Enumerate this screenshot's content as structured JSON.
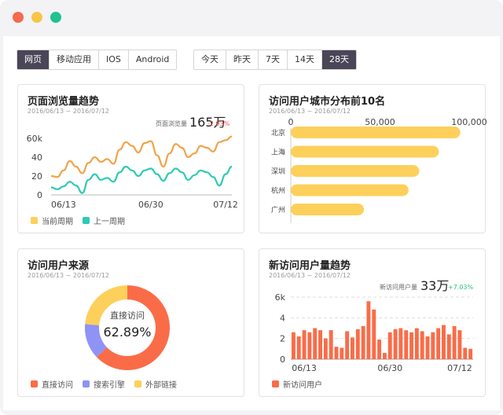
{
  "colors": {
    "orange": "#f0a44a",
    "teal": "#2fcab2",
    "yellow": "#fdd05b",
    "coral": "#fa6c48",
    "purple": "#8e93f5",
    "red_pct": "#f05050",
    "green_pct": "#2ec27e",
    "active_btn": "#4a4657"
  },
  "platform_tabs": [
    "网页",
    "移动应用",
    "IOS",
    "Android"
  ],
  "range_tabs": [
    "今天",
    "昨天",
    "7天",
    "14天",
    "28天"
  ],
  "cards": {
    "pv": {
      "title": "页面浏览量趋势",
      "date_range": "2016/06/13 ~ 2016/07/12",
      "stat_label": "页面浏览量",
      "stat_value": "165万",
      "stat_change": "-2.93%",
      "legend": [
        "当前周期",
        "上一周期"
      ]
    },
    "city": {
      "title": "访问用户城市分布前10名",
      "date_range": "2016/06/13 ~ 2016/07/12"
    },
    "source": {
      "title": "访问用户来源",
      "date_range": "2016/06/13 ~ 2016/07/12",
      "center_label": "直接访问",
      "center_value": "62.89%",
      "legend": [
        "直接访问",
        "搜索引擎",
        "外部链接"
      ]
    },
    "new_users": {
      "title": "新访问用户量趋势",
      "date_range": "2016/06/13 ~ 2016/07/12",
      "stat_label": "新访问用户量",
      "stat_value": "33万",
      "stat_change": "+7.03%",
      "legend": [
        "新访问用户"
      ]
    }
  },
  "chart_data": [
    {
      "type": "line",
      "y_ticks": [
        "60k",
        "40",
        "20",
        "0"
      ],
      "ylim": [
        0,
        65
      ],
      "x_ticks": [
        "06/13",
        "06/30",
        "07/12"
      ],
      "x": [
        0,
        1,
        2,
        3,
        4,
        5,
        6,
        7,
        8,
        9,
        10,
        11,
        12,
        13,
        14,
        15,
        16,
        17,
        18,
        19,
        20,
        21,
        22,
        23,
        24,
        25,
        26,
        27,
        28,
        29
      ],
      "series": [
        {
          "name": "当前周期",
          "values": [
            20,
            19,
            26,
            36,
            30,
            23,
            34,
            40,
            35,
            38,
            33,
            48,
            56,
            52,
            45,
            55,
            57,
            42,
            30,
            44,
            54,
            50,
            40,
            44,
            52,
            50,
            46,
            56,
            58,
            62
          ]
        },
        {
          "name": "上一周期",
          "values": [
            8,
            6,
            9,
            14,
            10,
            2,
            16,
            22,
            16,
            18,
            14,
            24,
            30,
            26,
            20,
            26,
            28,
            22,
            15,
            23,
            28,
            24,
            16,
            21,
            26,
            24,
            19,
            10,
            22,
            30
          ]
        }
      ]
    },
    {
      "type": "bar",
      "orientation": "horizontal",
      "x_ticks": [
        "0",
        "50,000",
        "100,000"
      ],
      "xlim": [
        0,
        100000
      ],
      "categories": [
        "北京",
        "上海",
        "深圳",
        "杭州",
        "广州"
      ],
      "values": [
        95000,
        83000,
        72000,
        66000,
        41000
      ]
    },
    {
      "type": "pie",
      "categories": [
        "直接访问",
        "搜索引擎",
        "外部链接"
      ],
      "values": [
        62.89,
        13.5,
        23.61
      ]
    },
    {
      "type": "bar",
      "y_ticks": [
        "6k",
        "4",
        "2",
        "0"
      ],
      "ylim": [
        0,
        6
      ],
      "x_ticks": [
        "06/13",
        "06/30",
        "07/12"
      ],
      "values": [
        2.6,
        2.2,
        2.8,
        2.6,
        3.0,
        2.8,
        2.0,
        2.8,
        1.2,
        1.1,
        2.7,
        2.1,
        2.9,
        3.2,
        5.6,
        4.8,
        1.9,
        0.6,
        2.6,
        2.9,
        3.0,
        2.8,
        2.6,
        3.0,
        2.7,
        2.2,
        2.6,
        3.0,
        3.3,
        2.4,
        3.2,
        2.8,
        1.1,
        1.0
      ]
    }
  ]
}
